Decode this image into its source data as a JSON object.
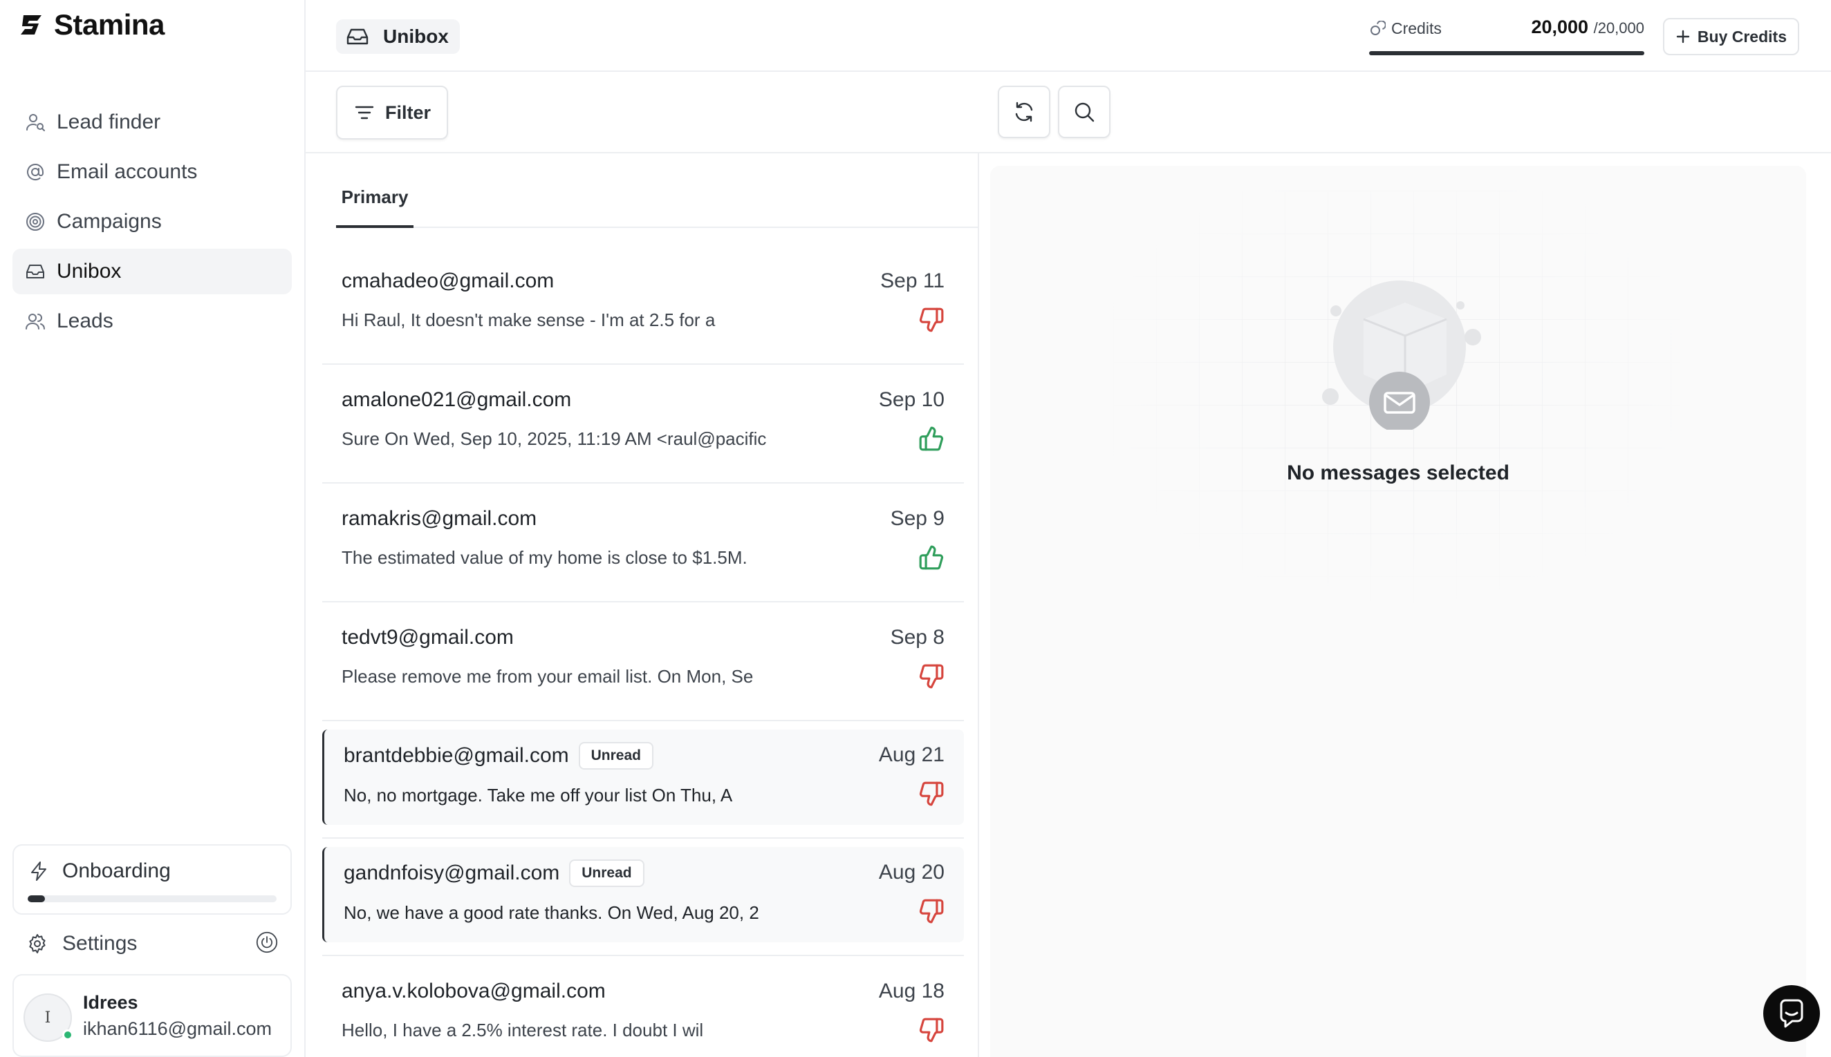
{
  "app": {
    "name": "Stamina"
  },
  "sidebar": {
    "items": [
      {
        "label": "Lead finder",
        "icon": "user-search-icon"
      },
      {
        "label": "Email accounts",
        "icon": "at-sign-icon"
      },
      {
        "label": "Campaigns",
        "icon": "target-icon"
      },
      {
        "label": "Unibox",
        "icon": "inbox-icon",
        "active": true
      },
      {
        "label": "Leads",
        "icon": "users-icon"
      }
    ],
    "onboarding": {
      "label": "Onboarding",
      "progress_fraction": 0.07
    },
    "settings_label": "Settings",
    "user": {
      "initial": "I",
      "name": "Idrees",
      "email": "ikhan6116@gmail.com"
    }
  },
  "header": {
    "page_title": "Unibox",
    "credits_label": "Credits",
    "credits_value": "20,000",
    "credits_total": "/20,000",
    "credits_fraction": 1.0,
    "buy_label": "Buy Credits"
  },
  "toolbar": {
    "filter_label": "Filter"
  },
  "tabs": [
    {
      "label": "Primary",
      "active": true
    }
  ],
  "emails": [
    {
      "sender": "cmahadeo@gmail.com",
      "date": "Sep 11",
      "preview": "Hi Raul, It doesn't make sense - I'm at 2.5 for a",
      "sentiment": "negative",
      "unread": false
    },
    {
      "sender": "amalone021@gmail.com",
      "date": "Sep 10",
      "preview": "Sure On Wed, Sep 10, 2025, 11:19 AM <raul@pacific",
      "sentiment": "positive",
      "unread": false
    },
    {
      "sender": "ramakris@gmail.com",
      "date": "Sep 9",
      "preview": "The estimated value of my home is close to $1.5M.",
      "sentiment": "positive",
      "unread": false
    },
    {
      "sender": "tedvt9@gmail.com",
      "date": "Sep 8",
      "preview": "Please remove me from your email list. On Mon, Se",
      "sentiment": "negative",
      "unread": false
    },
    {
      "sender": "brantdebbie@gmail.com",
      "date": "Aug 21",
      "preview": "No, no mortgage. Take me off your list On Thu, A",
      "sentiment": "negative",
      "unread": true,
      "badge": "Unread"
    },
    {
      "sender": "gandnfoisy@gmail.com",
      "date": "Aug 20",
      "preview": "No, we have a good rate thanks. On Wed, Aug 20, 2",
      "sentiment": "negative",
      "unread": true,
      "badge": "Unread"
    },
    {
      "sender": "anya.v.kolobova@gmail.com",
      "date": "Aug 18",
      "preview": "Hello, I have a 2.5% interest rate. I doubt I wil",
      "sentiment": "negative",
      "unread": false
    }
  ],
  "preview_pane": {
    "empty_title": "No messages selected"
  },
  "colors": {
    "negative": "#d6453d",
    "positive": "#2f9e5b",
    "accent": "#2b2f34",
    "online": "#2bb673"
  }
}
